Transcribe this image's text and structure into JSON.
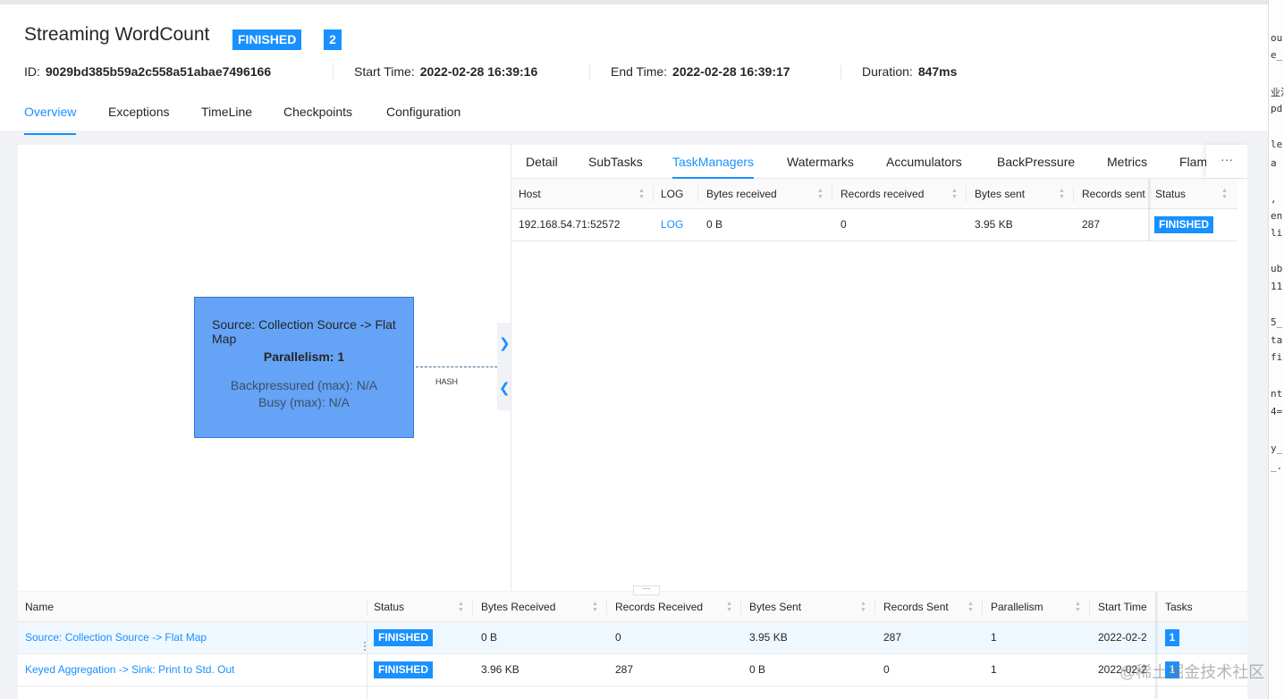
{
  "job": {
    "name": "Streaming WordCount",
    "status": "FINISHED",
    "task_count": "2",
    "id_label": "ID:",
    "id": "9029bd385b59a2c558a51abae7496166",
    "start_label": "Start Time:",
    "start": "2022-02-28 16:39:16",
    "end_label": "End Time:",
    "end": "2022-02-28 16:39:17",
    "duration_label": "Duration:",
    "duration": "847ms"
  },
  "nav": {
    "tabs": [
      "Overview",
      "Exceptions",
      "TimeLine",
      "Checkpoints",
      "Configuration"
    ],
    "active": "Overview"
  },
  "graph": {
    "node": {
      "title": "Source: Collection Source -> Flat Map",
      "parallelism": "Parallelism: 1",
      "backpressured": "Backpressured (max): N/A",
      "busy": "Busy (max): N/A"
    },
    "edge_label": "HASH",
    "expand_icon": "chevron-right-icon",
    "collapse_icon": "chevron-left-icon"
  },
  "detail": {
    "tabs": [
      "Detail",
      "SubTasks",
      "TaskManagers",
      "Watermarks",
      "Accumulators",
      "BackPressure",
      "Metrics",
      "Flam"
    ],
    "active": "TaskManagers",
    "more": "···",
    "columns": [
      "Host",
      "LOG",
      "Bytes received",
      "Records received",
      "Bytes sent",
      "Records sent",
      "Status"
    ],
    "rows": [
      {
        "host": "192.168.54.71:52572",
        "log": "LOG",
        "bytes_received": "0 B",
        "records_received": "0",
        "bytes_sent": "3.95 KB",
        "records_sent": "287",
        "status": "FINISHED"
      }
    ]
  },
  "vertices": {
    "resize_handle": "···",
    "columns": [
      "Name",
      "Status",
      "Bytes Received",
      "Records Received",
      "Bytes Sent",
      "Records Sent",
      "Parallelism",
      "Start Time",
      "Tasks"
    ],
    "rows": [
      {
        "name": "Source: Collection Source -> Flat Map",
        "status": "FINISHED",
        "bytes_received": "0 B",
        "records_received": "0",
        "bytes_sent": "3.95 KB",
        "records_sent": "287",
        "parallelism": "1",
        "start_time": "2022-02-2",
        "tasks": "1"
      },
      {
        "name": "Keyed Aggregation -> Sink: Print to Std. Out",
        "status": "FINISHED",
        "bytes_received": "3.96 KB",
        "records_received": "287",
        "bytes_sent": "0 B",
        "records_sent": "0",
        "parallelism": "1",
        "start_time": "2022-02-2",
        "tasks": "1"
      }
    ]
  },
  "side_terminal": [
    "ou",
    "e_",
    "业法",
    "pd",
    "le",
    " a",
    ",",
    "en",
    "li",
    "ub",
    "11",
    "5_",
    "ta",
    "fi",
    "nt",
    "4=",
    "y_",
    "_."
  ],
  "watermark": "@稀土掘金技术社区",
  "colors": {
    "accent": "#1890ff",
    "node_fill": "#64a3f5",
    "node_border": "#2a7ad8"
  }
}
